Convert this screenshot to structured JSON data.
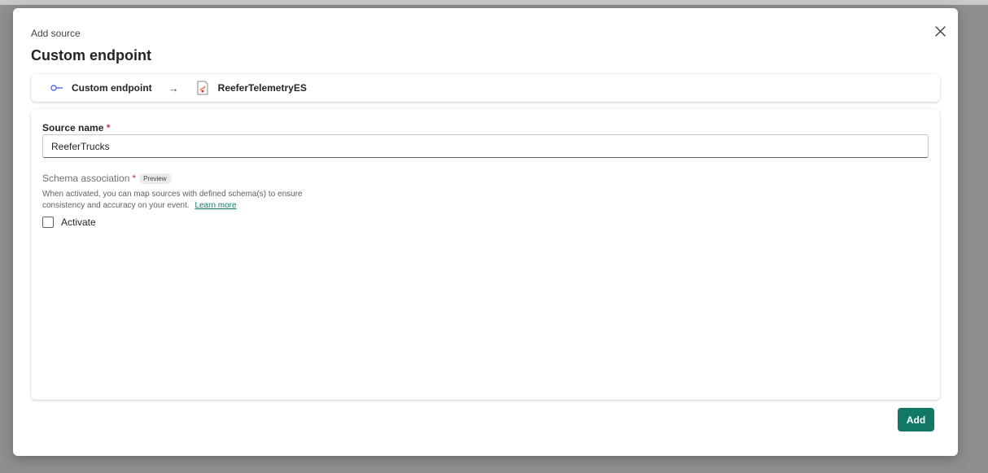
{
  "dialog": {
    "subtitle": "Add source",
    "title": "Custom endpoint"
  },
  "flow": {
    "source_label": "Custom endpoint",
    "arrow": "→",
    "destination_label": "ReeferTelemetryES"
  },
  "form": {
    "source_name": {
      "label": "Source name",
      "required_marker": "*",
      "value": "ReeferTrucks"
    },
    "schema": {
      "label": "Schema association",
      "required_marker": "*",
      "badge": "Preview",
      "description": "When activated, you can map sources with defined schema(s) to ensure consistency and accuracy on your event.",
      "link_text": "Learn more",
      "checkbox_label": "Activate",
      "checked": false
    }
  },
  "footer": {
    "add_label": "Add"
  },
  "colors": {
    "accent": "#117865",
    "required": "#c4314b"
  },
  "icons": {
    "close": "close-icon",
    "endpoint": "custom-endpoint-icon",
    "eventstream": "eventstream-icon"
  }
}
